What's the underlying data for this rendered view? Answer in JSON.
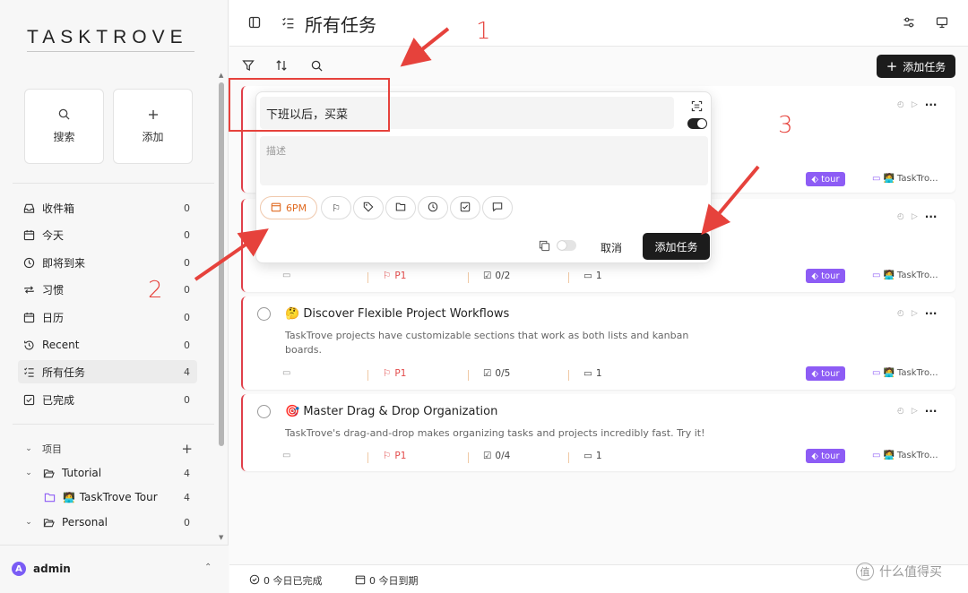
{
  "app": {
    "logo": "TASKTROVE"
  },
  "sidebar": {
    "quick": [
      {
        "label": "搜索",
        "icon": "search-icon"
      },
      {
        "label": "添加",
        "icon": "plus-icon"
      }
    ],
    "nav": [
      {
        "label": "收件箱",
        "count": "0",
        "icon": "inbox-icon"
      },
      {
        "label": "今天",
        "count": "0",
        "icon": "calendar-icon"
      },
      {
        "label": "即将到来",
        "count": "0",
        "icon": "clock-icon"
      },
      {
        "label": "习惯",
        "count": "0",
        "icon": "repeat-icon"
      },
      {
        "label": "日历",
        "count": "0",
        "icon": "calendar-icon"
      },
      {
        "label": "Recent",
        "count": "0",
        "icon": "history-icon"
      },
      {
        "label": "所有任务",
        "count": "4",
        "icon": "list-icon"
      },
      {
        "label": "已完成",
        "count": "0",
        "icon": "check-square-icon"
      }
    ],
    "projects_label": "项目",
    "groups": [
      {
        "label": "Tutorial",
        "count": "4"
      },
      {
        "label": "TaskTrove Tour",
        "count": "4"
      },
      {
        "label": "Personal",
        "count": "0"
      }
    ],
    "user": {
      "name": "admin",
      "initial": "A"
    }
  },
  "header": {
    "title": "所有任务"
  },
  "toolbar": {
    "add_task": "添加任务"
  },
  "popup": {
    "title_value": "下班以后，买菜",
    "desc_placeholder": "描述",
    "date_chip": "6PM",
    "cancel": "取消",
    "submit": "添加任务"
  },
  "tasks": [
    {
      "emoji": "",
      "title": "",
      "desc": "",
      "date": "",
      "priority": "",
      "subtasks": "",
      "comments": "",
      "tag": "tour",
      "project": "TaskTro..."
    },
    {
      "emoji": "",
      "title": "",
      "desc": "",
      "date": "",
      "priority": "P1",
      "subtasks": "0/2",
      "comments": "1",
      "tag": "tour",
      "project": "TaskTro..."
    },
    {
      "emoji": "🤔",
      "title": "Discover Flexible Project Workflows",
      "desc": "TaskTrove projects have customizable sections that work as both lists and kanban boards.",
      "priority": "P1",
      "subtasks": "0/5",
      "comments": "1",
      "tag": "tour",
      "project": "TaskTro..."
    },
    {
      "emoji": "🎯",
      "title": "Master Drag & Drop Organization",
      "desc": "TaskTrove's drag-and-drop makes organizing tasks and projects incredibly fast. Try it!",
      "priority": "P1",
      "subtasks": "0/4",
      "comments": "1",
      "tag": "tour",
      "project": "TaskTro..."
    }
  ],
  "footer": {
    "completed": "0 今日已完成",
    "due": "0 今日到期"
  },
  "annotations": {
    "n1": "1",
    "n2": "2",
    "n3": "3"
  },
  "watermark": {
    "text": "什么值得买",
    "icon_char": "值"
  },
  "colors": {
    "accent": "#1c1c1c",
    "priority": "#e34b4b",
    "tag": "#8d5cf5",
    "annotation": "#e6423c"
  }
}
